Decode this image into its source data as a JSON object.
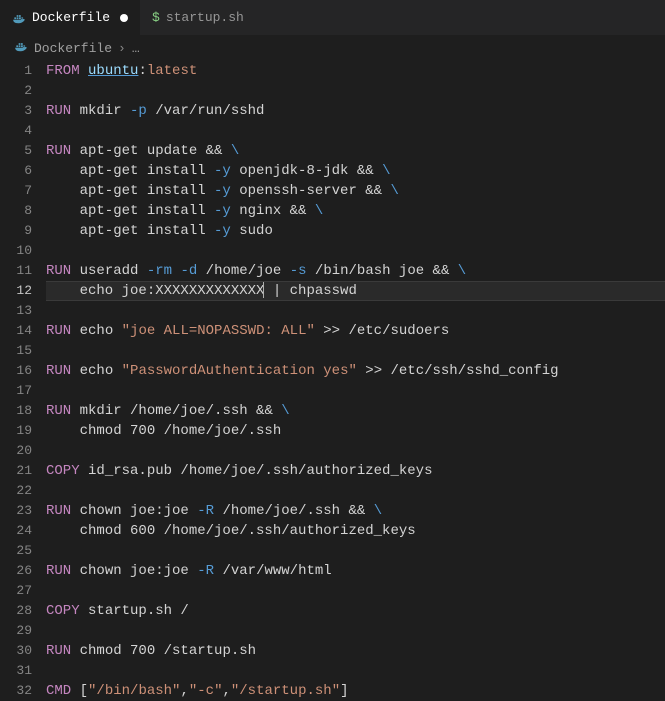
{
  "tabs": [
    {
      "label": "Dockerfile",
      "active": true,
      "dirty": true,
      "icon": "docker-icon"
    },
    {
      "label": "startup.sh",
      "active": false,
      "dirty": false,
      "icon": "bash-icon",
      "prefix": "$"
    }
  ],
  "breadcrumbs": {
    "icon": "docker-icon",
    "file": "Dockerfile",
    "sep": "›",
    "more": "…"
  },
  "editor": {
    "active_line": 12,
    "lines": [
      {
        "n": 1,
        "t": [
          [
            "kw",
            "FROM"
          ],
          [
            "op",
            " "
          ],
          [
            "img",
            "ubuntu"
          ],
          [
            "op",
            ":"
          ],
          [
            "tag",
            "latest"
          ]
        ]
      },
      {
        "n": 2,
        "t": []
      },
      {
        "n": 3,
        "t": [
          [
            "kw",
            "RUN"
          ],
          [
            "op",
            " mkdir "
          ],
          [
            "flag",
            "-p"
          ],
          [
            "op",
            " /var/run/sshd"
          ]
        ]
      },
      {
        "n": 4,
        "t": []
      },
      {
        "n": 5,
        "t": [
          [
            "kw",
            "RUN"
          ],
          [
            "op",
            " apt-get update && "
          ],
          [
            "cont",
            "\\"
          ]
        ]
      },
      {
        "n": 6,
        "t": [
          [
            "op",
            "    apt-get install "
          ],
          [
            "flag",
            "-y"
          ],
          [
            "op",
            " openjdk-8-jdk && "
          ],
          [
            "cont",
            "\\"
          ]
        ]
      },
      {
        "n": 7,
        "t": [
          [
            "op",
            "    apt-get install "
          ],
          [
            "flag",
            "-y"
          ],
          [
            "op",
            " openssh-server && "
          ],
          [
            "cont",
            "\\"
          ]
        ]
      },
      {
        "n": 8,
        "t": [
          [
            "op",
            "    apt-get install "
          ],
          [
            "flag",
            "-y"
          ],
          [
            "op",
            " nginx && "
          ],
          [
            "cont",
            "\\"
          ]
        ]
      },
      {
        "n": 9,
        "t": [
          [
            "op",
            "    apt-get install "
          ],
          [
            "flag",
            "-y"
          ],
          [
            "op",
            " sudo"
          ]
        ]
      },
      {
        "n": 10,
        "t": []
      },
      {
        "n": 11,
        "t": [
          [
            "kw",
            "RUN"
          ],
          [
            "op",
            " useradd "
          ],
          [
            "flag",
            "-rm"
          ],
          [
            "op",
            " "
          ],
          [
            "flag",
            "-d"
          ],
          [
            "op",
            " /home/joe "
          ],
          [
            "flag",
            "-s"
          ],
          [
            "op",
            " /bin/bash joe && "
          ],
          [
            "cont",
            "\\"
          ]
        ]
      },
      {
        "n": 12,
        "t": [
          [
            "op",
            "    echo joe:XXXXXXXXXXXXX"
          ],
          [
            "cursor",
            ""
          ],
          [
            "op",
            " | chpasswd"
          ]
        ]
      },
      {
        "n": 13,
        "t": []
      },
      {
        "n": 14,
        "t": [
          [
            "kw",
            "RUN"
          ],
          [
            "op",
            " echo "
          ],
          [
            "str",
            "\"joe ALL=NOPASSWD: ALL\""
          ],
          [
            "op",
            " >> /etc/sudoers"
          ]
        ]
      },
      {
        "n": 15,
        "t": []
      },
      {
        "n": 16,
        "t": [
          [
            "kw",
            "RUN"
          ],
          [
            "op",
            " echo "
          ],
          [
            "str",
            "\"PasswordAuthentication yes\""
          ],
          [
            "op",
            " >> /etc/ssh/sshd_config"
          ]
        ]
      },
      {
        "n": 17,
        "t": []
      },
      {
        "n": 18,
        "t": [
          [
            "kw",
            "RUN"
          ],
          [
            "op",
            " mkdir /home/joe/.ssh && "
          ],
          [
            "cont",
            "\\"
          ]
        ]
      },
      {
        "n": 19,
        "t": [
          [
            "op",
            "    chmod 700 /home/joe/.ssh"
          ]
        ]
      },
      {
        "n": 20,
        "t": []
      },
      {
        "n": 21,
        "t": [
          [
            "kw",
            "COPY"
          ],
          [
            "op",
            " id_rsa.pub /home/joe/.ssh/authorized_keys"
          ]
        ]
      },
      {
        "n": 22,
        "t": []
      },
      {
        "n": 23,
        "t": [
          [
            "kw",
            "RUN"
          ],
          [
            "op",
            " chown joe:joe "
          ],
          [
            "flag",
            "-R"
          ],
          [
            "op",
            " /home/joe/.ssh && "
          ],
          [
            "cont",
            "\\"
          ]
        ]
      },
      {
        "n": 24,
        "t": [
          [
            "op",
            "    chmod 600 /home/joe/.ssh/authorized_keys"
          ]
        ]
      },
      {
        "n": 25,
        "t": []
      },
      {
        "n": 26,
        "t": [
          [
            "kw",
            "RUN"
          ],
          [
            "op",
            " chown joe:joe "
          ],
          [
            "flag",
            "-R"
          ],
          [
            "op",
            " /var/www/html"
          ]
        ]
      },
      {
        "n": 27,
        "t": []
      },
      {
        "n": 28,
        "t": [
          [
            "kw",
            "COPY"
          ],
          [
            "op",
            " startup.sh /"
          ]
        ]
      },
      {
        "n": 29,
        "t": []
      },
      {
        "n": 30,
        "t": [
          [
            "kw",
            "RUN"
          ],
          [
            "op",
            " chmod 700 /startup.sh"
          ]
        ]
      },
      {
        "n": 31,
        "t": []
      },
      {
        "n": 32,
        "t": [
          [
            "kw",
            "CMD"
          ],
          [
            "op",
            " ["
          ],
          [
            "str",
            "\"/bin/bash\""
          ],
          [
            "op",
            ","
          ],
          [
            "str",
            "\"-c\""
          ],
          [
            "op",
            ","
          ],
          [
            "str",
            "\"/startup.sh\""
          ],
          [
            "op",
            "]"
          ]
        ]
      }
    ]
  }
}
